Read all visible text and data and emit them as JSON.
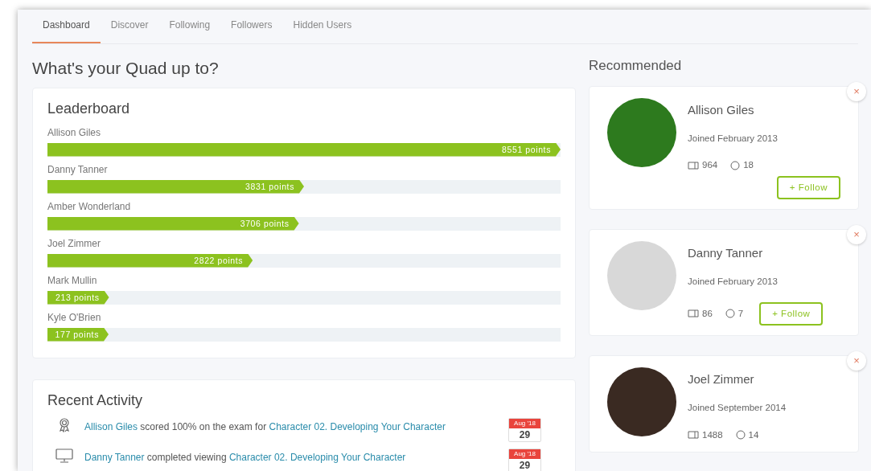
{
  "tabs": [
    {
      "label": "Dashboard",
      "selected": true
    },
    {
      "label": "Discover",
      "selected": false
    },
    {
      "label": "Following",
      "selected": false
    },
    {
      "label": "Followers",
      "selected": false
    },
    {
      "label": "Hidden Users",
      "selected": false
    }
  ],
  "heading": "What's your Quad up to?",
  "leaderboard": {
    "title": "Leaderboard",
    "entries": [
      {
        "name": "Allison Giles",
        "points": "8551 points",
        "level": 1.0
      },
      {
        "name": "Danny Tanner",
        "points": "3831 points",
        "level": 0.5
      },
      {
        "name": "Amber Wonderland",
        "points": "3706 points",
        "level": 0.49
      },
      {
        "name": "Joel Zimmer",
        "points": "2822 points",
        "level": 0.4
      },
      {
        "name": "Mark Mullin",
        "points": "213 points",
        "level": 0.12
      },
      {
        "name": "Kyle O'Brien",
        "points": "177 points",
        "level": 0.117
      }
    ]
  },
  "recent_activity": {
    "title": "Recent Activity",
    "items": [
      {
        "kind": "award",
        "actor": "Allison Giles",
        "action": "scored 100% on the exam for",
        "target": "Character 02. Developing Your Character",
        "month": "Aug '18",
        "day": "29"
      },
      {
        "kind": "viewing",
        "actor": "Danny Tanner",
        "action": "completed viewing",
        "target": "Character 02. Developing Your Character",
        "month": "Aug '18",
        "day": "29"
      }
    ]
  },
  "recommended": {
    "title": "Recommended",
    "users": [
      {
        "name": "Allison Giles",
        "joined": "Joined February 2013",
        "posts": "964",
        "comments": "18",
        "follow": "+ Follow",
        "close": "×"
      },
      {
        "name": "Danny Tanner",
        "joined": "Joined February 2013",
        "posts": "86",
        "comments": "7",
        "follow": "+ Follow",
        "close": "×"
      },
      {
        "name": "Joel Zimmer",
        "joined": "Joined September 2014",
        "posts": "1488",
        "comments": "14",
        "close": "×"
      }
    ]
  }
}
